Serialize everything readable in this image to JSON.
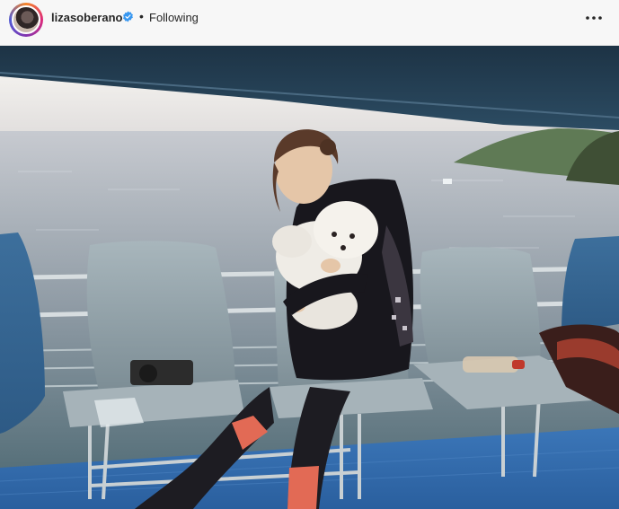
{
  "header": {
    "username": "lizasoberano",
    "verified": true,
    "separator": "•",
    "follow_status": "Following"
  },
  "icons": {
    "avatar": "profile-avatar",
    "badge": "verified-badge-icon",
    "menu": "more-options-icon"
  },
  "colors": {
    "verified_blue": "#3897f0",
    "header_bg": "#f7f7f7"
  },
  "photo": {
    "description": ""
  }
}
